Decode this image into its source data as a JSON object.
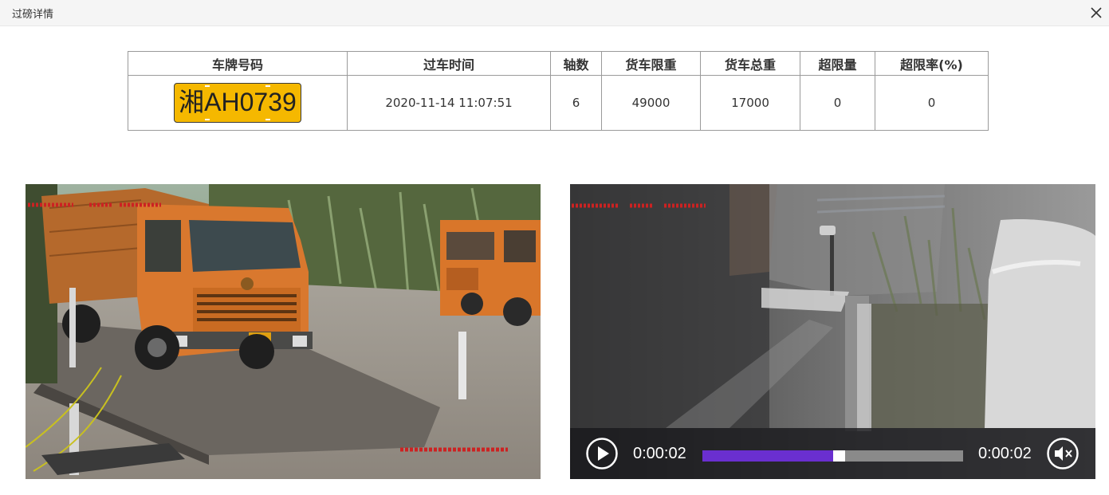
{
  "window": {
    "title": "过磅详情"
  },
  "table": {
    "headers": [
      "车牌号码",
      "过车时间",
      "轴数",
      "货车限重",
      "货车总重",
      "超限量",
      "超限率(%)"
    ],
    "row": {
      "plate": "湘AH0739",
      "time": "2020-11-14 11:07:51",
      "axles": "6",
      "weight_limit": "49000",
      "total_weight": "17000",
      "overload_amount": "0",
      "overload_rate": "0"
    }
  },
  "photo": {
    "icon": "truck-snapshot-image"
  },
  "video": {
    "current_time": "0:00:02",
    "duration": "0:00:02",
    "progress": 0.5,
    "muted": true,
    "accent_color": "#6a2fd0"
  },
  "colors": {
    "plate_background": "#f5b800",
    "truck_orange": "#d9762a"
  }
}
